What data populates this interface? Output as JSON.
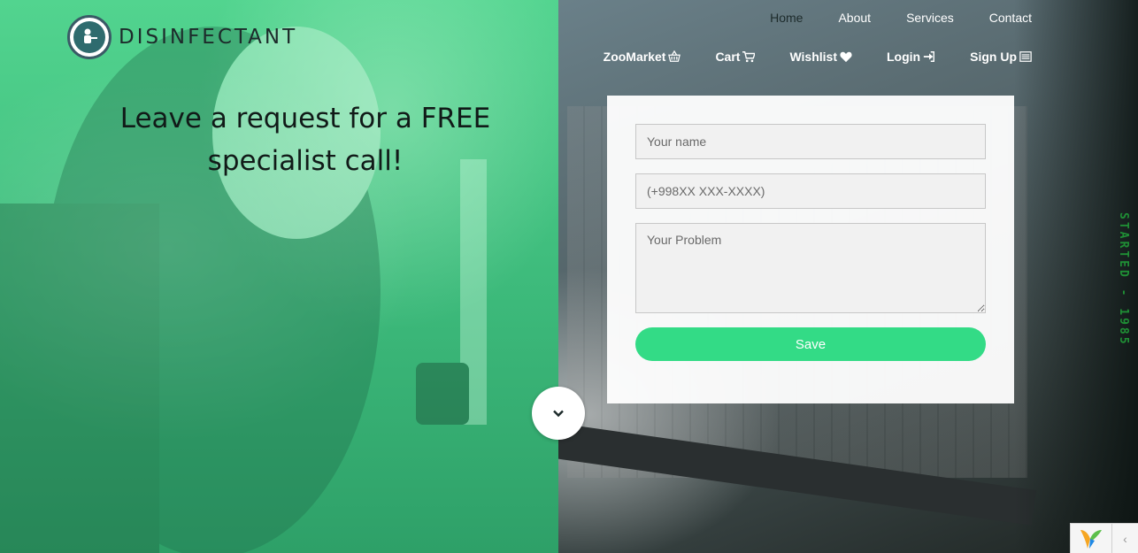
{
  "brand": {
    "name": "DISINFECTANT",
    "logo_icon": "disinfector-person-icon"
  },
  "nav": {
    "top": [
      {
        "label": "Home",
        "active": true
      },
      {
        "label": "About",
        "active": false
      },
      {
        "label": "Services",
        "active": false
      },
      {
        "label": "Contact",
        "active": false
      }
    ],
    "bottom": [
      {
        "label": "ZooMarket",
        "icon": "basket-icon"
      },
      {
        "label": "Cart",
        "icon": "cart-icon"
      },
      {
        "label": "Wishlist",
        "icon": "heart-icon"
      },
      {
        "label": "Login",
        "icon": "sign-in-icon"
      },
      {
        "label": "Sign Up",
        "icon": "list-icon"
      }
    ]
  },
  "hero": {
    "headline": "Leave a request for a FREE specialist call!"
  },
  "form": {
    "name_placeholder": "Your name",
    "phone_placeholder": "(+998XX XXX-XXXX)",
    "problem_placeholder": "Your Problem",
    "save_label": "Save"
  },
  "side_text": "STARTED - 1985",
  "colors": {
    "accent_green": "#33db86",
    "left_overlay": "#3cb97a",
    "side_text": "#1f8f35"
  },
  "icons": {
    "scroll_down": "chevron-down-icon",
    "debug_toolbar": "yii-logo-icon",
    "collapse": "chevron-left-icon"
  }
}
